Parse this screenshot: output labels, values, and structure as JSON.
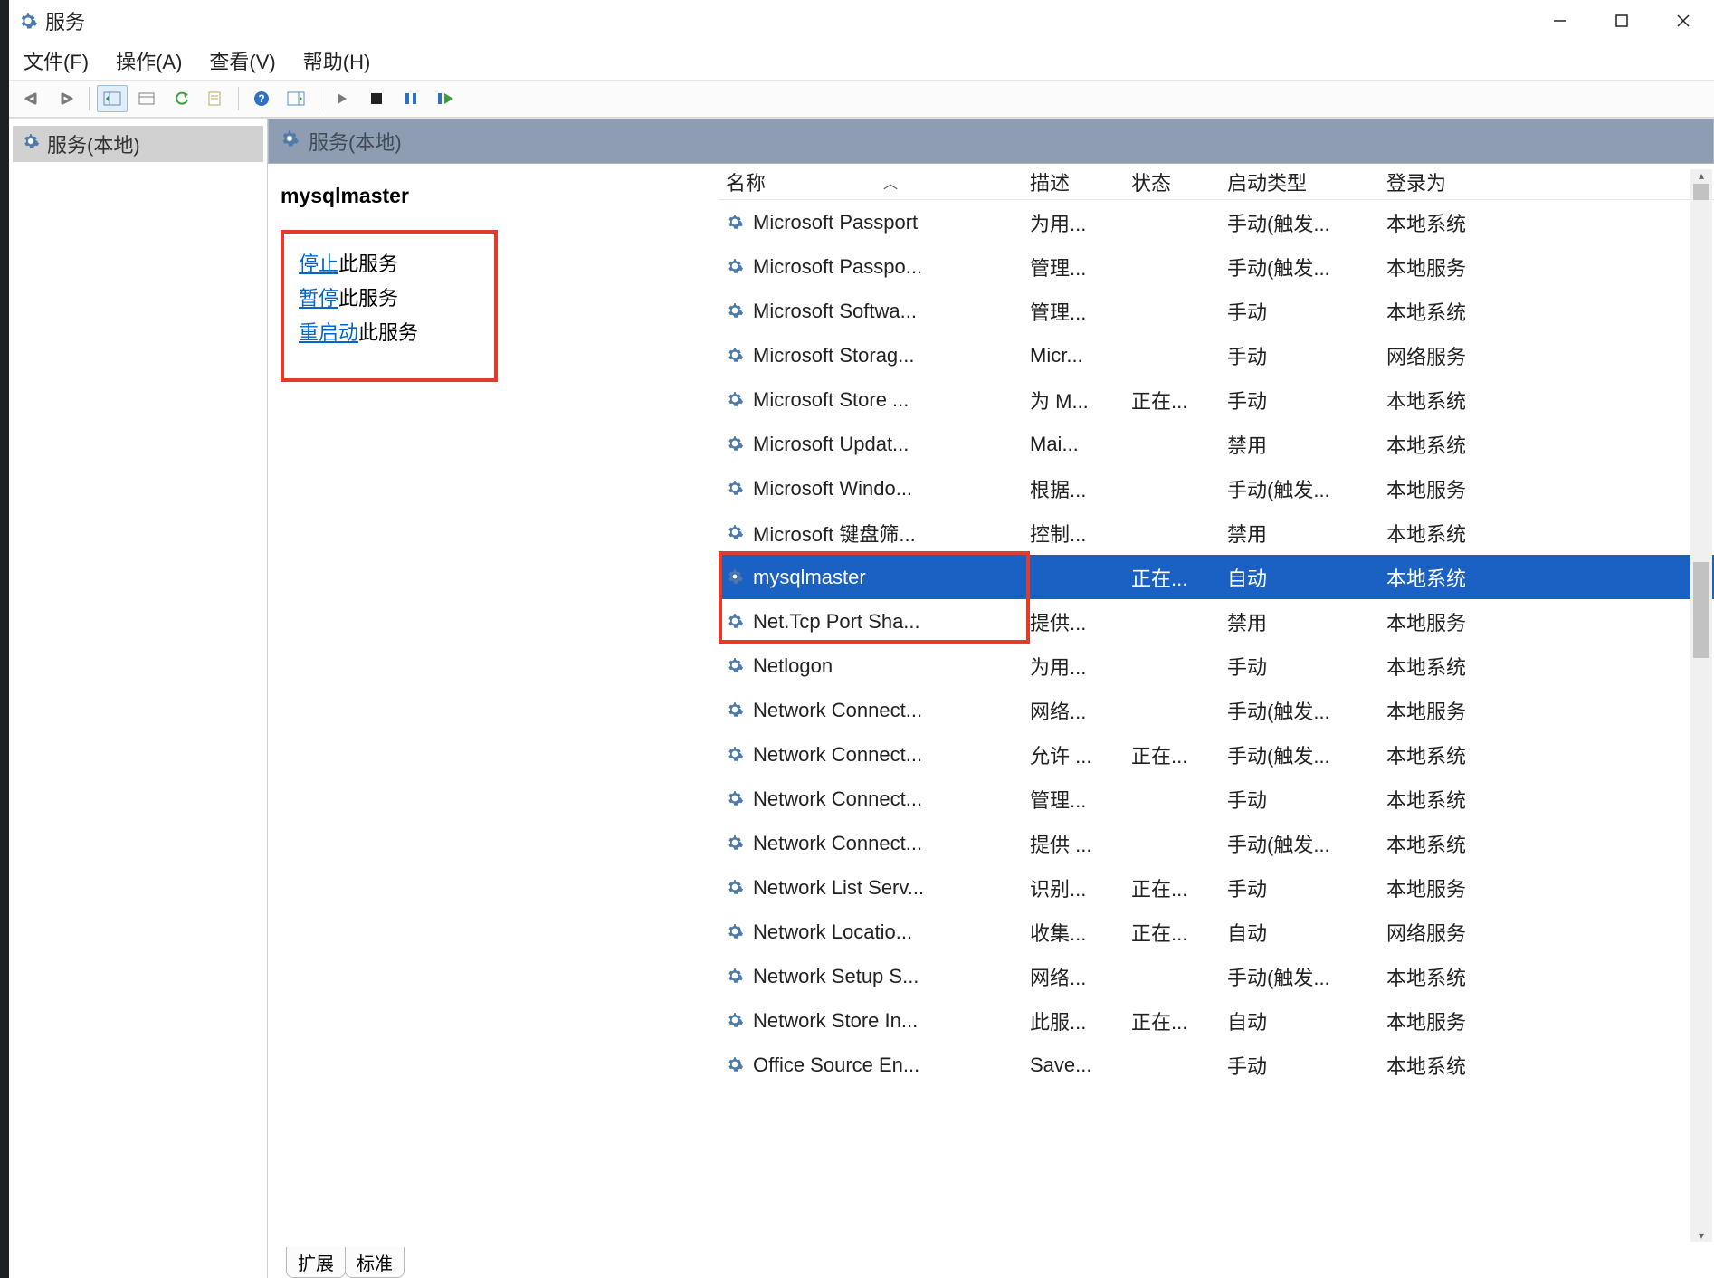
{
  "window": {
    "title": "服务"
  },
  "menu": {
    "file": "文件(F)",
    "action": "操作(A)",
    "view": "查看(V)",
    "help": "帮助(H)"
  },
  "tree": {
    "root_label": "服务(本地)"
  },
  "main_header": {
    "label": "服务(本地)"
  },
  "detail": {
    "selected_name": "mysqlmaster",
    "stop_action": "停止",
    "pause_action": "暂停",
    "restart_action": "重启动",
    "this_service_suffix": "此服务"
  },
  "columns": {
    "name": "名称",
    "description": "描述",
    "status": "状态",
    "startup_type": "启动类型",
    "logon_as": "登录为"
  },
  "tabs": {
    "extended": "扩展",
    "standard": "标准"
  },
  "services": [
    {
      "name": "Microsoft Passport",
      "desc": "为用...",
      "status": "",
      "startup": "手动(触发...",
      "logon": "本地系统"
    },
    {
      "name": "Microsoft Passpo...",
      "desc": "管理...",
      "status": "",
      "startup": "手动(触发...",
      "logon": "本地服务"
    },
    {
      "name": "Microsoft Softwa...",
      "desc": "管理...",
      "status": "",
      "startup": "手动",
      "logon": "本地系统"
    },
    {
      "name": "Microsoft Storag...",
      "desc": "Micr...",
      "status": "",
      "startup": "手动",
      "logon": "网络服务"
    },
    {
      "name": "Microsoft Store ...",
      "desc": "为 M...",
      "status": "正在...",
      "startup": "手动",
      "logon": "本地系统"
    },
    {
      "name": "Microsoft Updat...",
      "desc": "Mai...",
      "status": "",
      "startup": "禁用",
      "logon": "本地系统"
    },
    {
      "name": "Microsoft Windo...",
      "desc": "根据...",
      "status": "",
      "startup": "手动(触发...",
      "logon": "本地服务"
    },
    {
      "name": "Microsoft 键盘筛...",
      "desc": "控制...",
      "status": "",
      "startup": "禁用",
      "logon": "本地系统"
    },
    {
      "name": "mysqlmaster",
      "desc": "",
      "status": "正在...",
      "startup": "自动",
      "logon": "本地系统",
      "selected": true
    },
    {
      "name": "Net.Tcp Port Sha...",
      "desc": "提供...",
      "status": "",
      "startup": "禁用",
      "logon": "本地服务"
    },
    {
      "name": "Netlogon",
      "desc": "为用...",
      "status": "",
      "startup": "手动",
      "logon": "本地系统"
    },
    {
      "name": "Network Connect...",
      "desc": "网络...",
      "status": "",
      "startup": "手动(触发...",
      "logon": "本地服务"
    },
    {
      "name": "Network Connect...",
      "desc": "允许 ...",
      "status": "正在...",
      "startup": "手动(触发...",
      "logon": "本地系统"
    },
    {
      "name": "Network Connect...",
      "desc": "管理...",
      "status": "",
      "startup": "手动",
      "logon": "本地系统"
    },
    {
      "name": "Network Connect...",
      "desc": "提供 ...",
      "status": "",
      "startup": "手动(触发...",
      "logon": "本地系统"
    },
    {
      "name": "Network List Serv...",
      "desc": "识别...",
      "status": "正在...",
      "startup": "手动",
      "logon": "本地服务"
    },
    {
      "name": "Network Locatio...",
      "desc": "收集...",
      "status": "正在...",
      "startup": "自动",
      "logon": "网络服务"
    },
    {
      "name": "Network Setup S...",
      "desc": "网络...",
      "status": "",
      "startup": "手动(触发...",
      "logon": "本地系统"
    },
    {
      "name": "Network Store In...",
      "desc": "此服...",
      "status": "正在...",
      "startup": "自动",
      "logon": "本地服务"
    },
    {
      "name": "Office  Source En...",
      "desc": "Save...",
      "status": "",
      "startup": "手动",
      "logon": "本地系统"
    }
  ]
}
